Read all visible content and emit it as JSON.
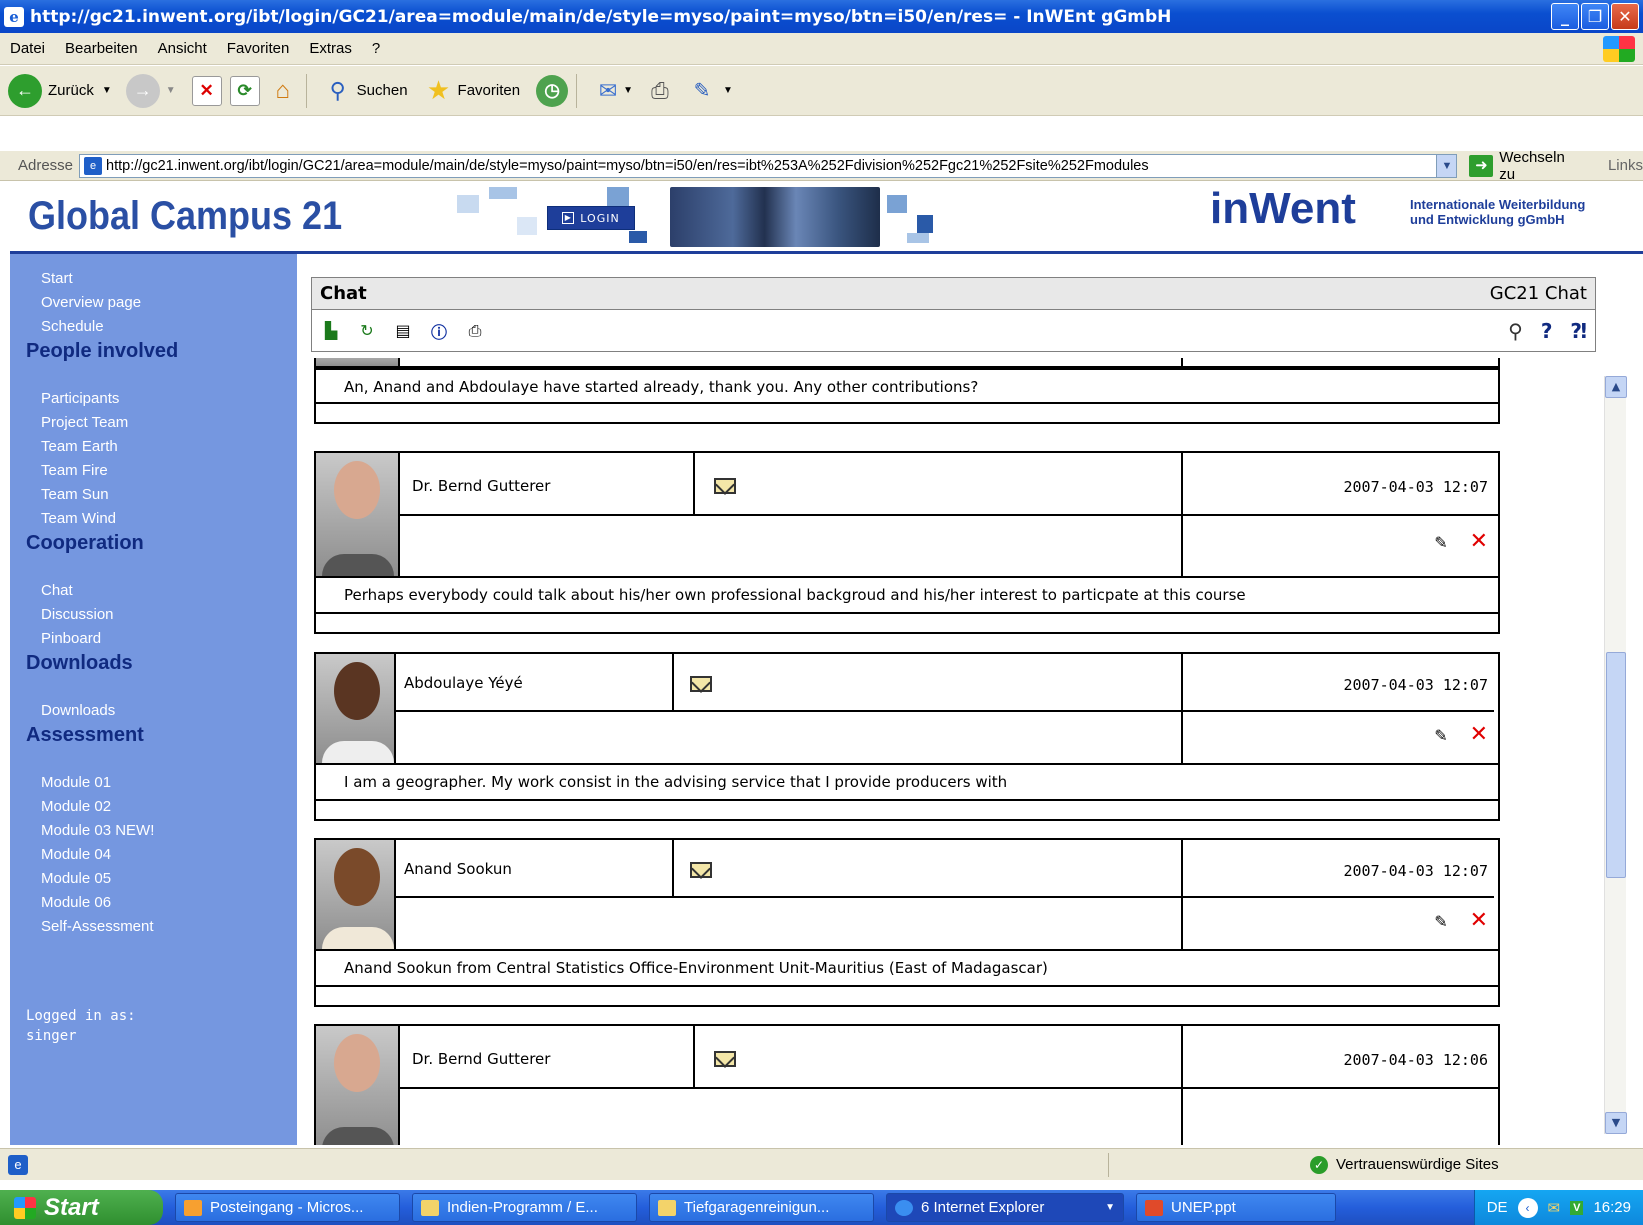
{
  "window": {
    "title": "http://gc21.inwent.org/ibt/login/GC21/area=module/main/de/style=myso/paint=myso/btn=i50/en/res= - InWEnt gGmbH",
    "controls": [
      "_",
      "❐",
      "✕"
    ]
  },
  "menu": [
    "Datei",
    "Bearbeiten",
    "Ansicht",
    "Favoriten",
    "Extras",
    "?"
  ],
  "toolbar": {
    "back_label": "Zurück",
    "search_label": "Suchen",
    "favorites_label": "Favoriten"
  },
  "address": {
    "label": "Adresse",
    "url": "http://gc21.inwent.org/ibt/login/GC21/area=module/main/de/style=myso/paint=myso/btn=i50/en/res=ibt%253A%252Fdivision%252Fgc21%252Fsite%252Fmodules",
    "go_label": "Wechseln zu",
    "links_label": "Links"
  },
  "site": {
    "logo": "Global Campus 21",
    "login_label": "LOGIN",
    "brand": "in",
    "brand2": "Went",
    "brand_sub1": "Internationale Weiterbildung",
    "brand_sub2": "und Entwicklung gGmbH"
  },
  "sidebar": {
    "nav1": [
      "Start",
      "Overview page",
      "Schedule"
    ],
    "sec_people": "People involved",
    "people": [
      "Participants",
      "Project Team",
      "Team Earth",
      "Team Fire",
      "Team Sun",
      "Team Wind"
    ],
    "sec_coop": "Cooperation",
    "coop": [
      "Chat",
      "Discussion",
      "Pinboard"
    ],
    "sec_downloads": "Downloads",
    "downloads": [
      "Downloads"
    ],
    "sec_assessment": "Assessment",
    "assessment": [
      "Module 01",
      "Module 02",
      "Module 03 NEW!",
      "Module 04",
      "Module 05",
      "Module 06",
      "Self-Assessment"
    ],
    "logged_label": "Logged in as:",
    "logged_user": "singer"
  },
  "chat": {
    "title": "Chat",
    "right_title": "GC21 Chat",
    "first_message": "An, Anand and Abdoulaye have started already, thank you. Any other contributions?",
    "posts": [
      {
        "name": "Dr. Bernd Gutterer",
        "date": "2007-04-03 12:07",
        "message": "Perhaps everybody could talk about his/her own professional backgroud and his/her interest to particpate at this course"
      },
      {
        "name": "Abdoulaye Yéyé",
        "date": "2007-04-03 12:07",
        "message": "I am a geographer. My work consist in the advising service that I provide producers with"
      },
      {
        "name": "Anand Sookun",
        "date": "2007-04-03 12:07",
        "message": "Anand Sookun from Central Statistics Office-Environment Unit-Mauritius (East of Madagascar)"
      },
      {
        "name": "Dr. Bernd Gutterer",
        "date": "2007-04-03 12:06",
        "message": ""
      }
    ]
  },
  "status": {
    "zone": "Vertrauenswürdige Sites"
  },
  "taskbar": {
    "start": "Start",
    "tasks": [
      "Posteingang - Micros...",
      "Indien-Programm / E...",
      "Tiefgaragenreinigun...",
      "6 Internet Explorer",
      "UNEP.ppt"
    ],
    "lang": "DE",
    "clock": "16:29"
  }
}
